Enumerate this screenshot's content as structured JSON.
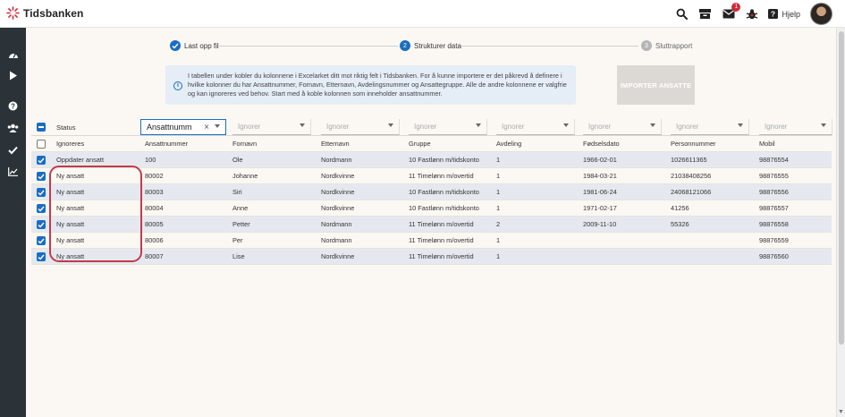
{
  "app": {
    "logo": "Tidsbanken",
    "help_label": "Hjelp",
    "notification_count": "1"
  },
  "stepper": [
    {
      "label": "Last opp fil",
      "state": "done"
    },
    {
      "label": "Strukturer data",
      "state": "active",
      "number": "2"
    },
    {
      "label": "Sluttrapport",
      "state": "todo",
      "number": "3"
    }
  ],
  "info": {
    "text": "I tabellen under kobler du kolonnene i Excelarket ditt mot riktig felt i Tidsbanken. For å kunne importere er det påkrevd å definere i hvilke kolonner du har Ansattnummer, Fornavn, Etternavn, Avdelingsnummer og Ansattegruppe. Alle de andre kolonnene er valgfrie og kan ignoreres ved behov. Start med å koble kolonnen som inneholder ansattnummer."
  },
  "import_button": "IMPORTER ANSATTE",
  "table": {
    "status_header": "Status",
    "selectors": [
      {
        "value": "Ansattnumm",
        "active": true
      },
      {
        "value": "Ignorer"
      },
      {
        "value": "Ignorer"
      },
      {
        "value": "Ignorer"
      },
      {
        "value": "Ignorer"
      },
      {
        "value": "Ignorer"
      },
      {
        "value": "Ignorer"
      },
      {
        "value": "Ignorer"
      }
    ],
    "column_names": [
      "Ignoreres",
      "Ansattnummer",
      "Fornavn",
      "Etternavn",
      "Gruppe",
      "Avdeling",
      "Fødselsdato",
      "Personnummer",
      "Mobil"
    ],
    "rows": [
      [
        "Oppdater ansatt",
        "100",
        "Ole",
        "Nordmann",
        "10 Fastlønn m/tidskonto",
        "1",
        "1966-02-01",
        "1026611365",
        "98876554"
      ],
      [
        "Ny ansatt",
        "80002",
        "Johanne",
        "Nordkvinne",
        "11 Timelønn m/overtid",
        "1",
        "1984-03-21",
        "21038408256",
        "98876555"
      ],
      [
        "Ny ansatt",
        "80003",
        "Siri",
        "Nordkvinne",
        "10 Fastlønn m/tidskonto",
        "1",
        "1981-06-24",
        "24068121066",
        "98876556"
      ],
      [
        "Ny ansatt",
        "80004",
        "Anne",
        "Nordkvinne",
        "10 Fastlønn m/tidskonto",
        "1",
        "1971-02-17",
        "41256",
        "98876557"
      ],
      [
        "Ny ansatt",
        "80005",
        "Petter",
        "Nordmann",
        "11 Timelønn m/overtid",
        "2",
        "2009-11-10",
        "55326",
        "98876558"
      ],
      [
        "Ny ansatt",
        "80006",
        "Per",
        "Nordmann",
        "11 Timelønn m/overtid",
        "1",
        "",
        "",
        "98876559"
      ],
      [
        "Ny ansatt",
        "80007",
        "Lise",
        "Nordkvinne",
        "11 Timelønn m/overtid",
        "1",
        "",
        "",
        "98876560"
      ]
    ]
  }
}
